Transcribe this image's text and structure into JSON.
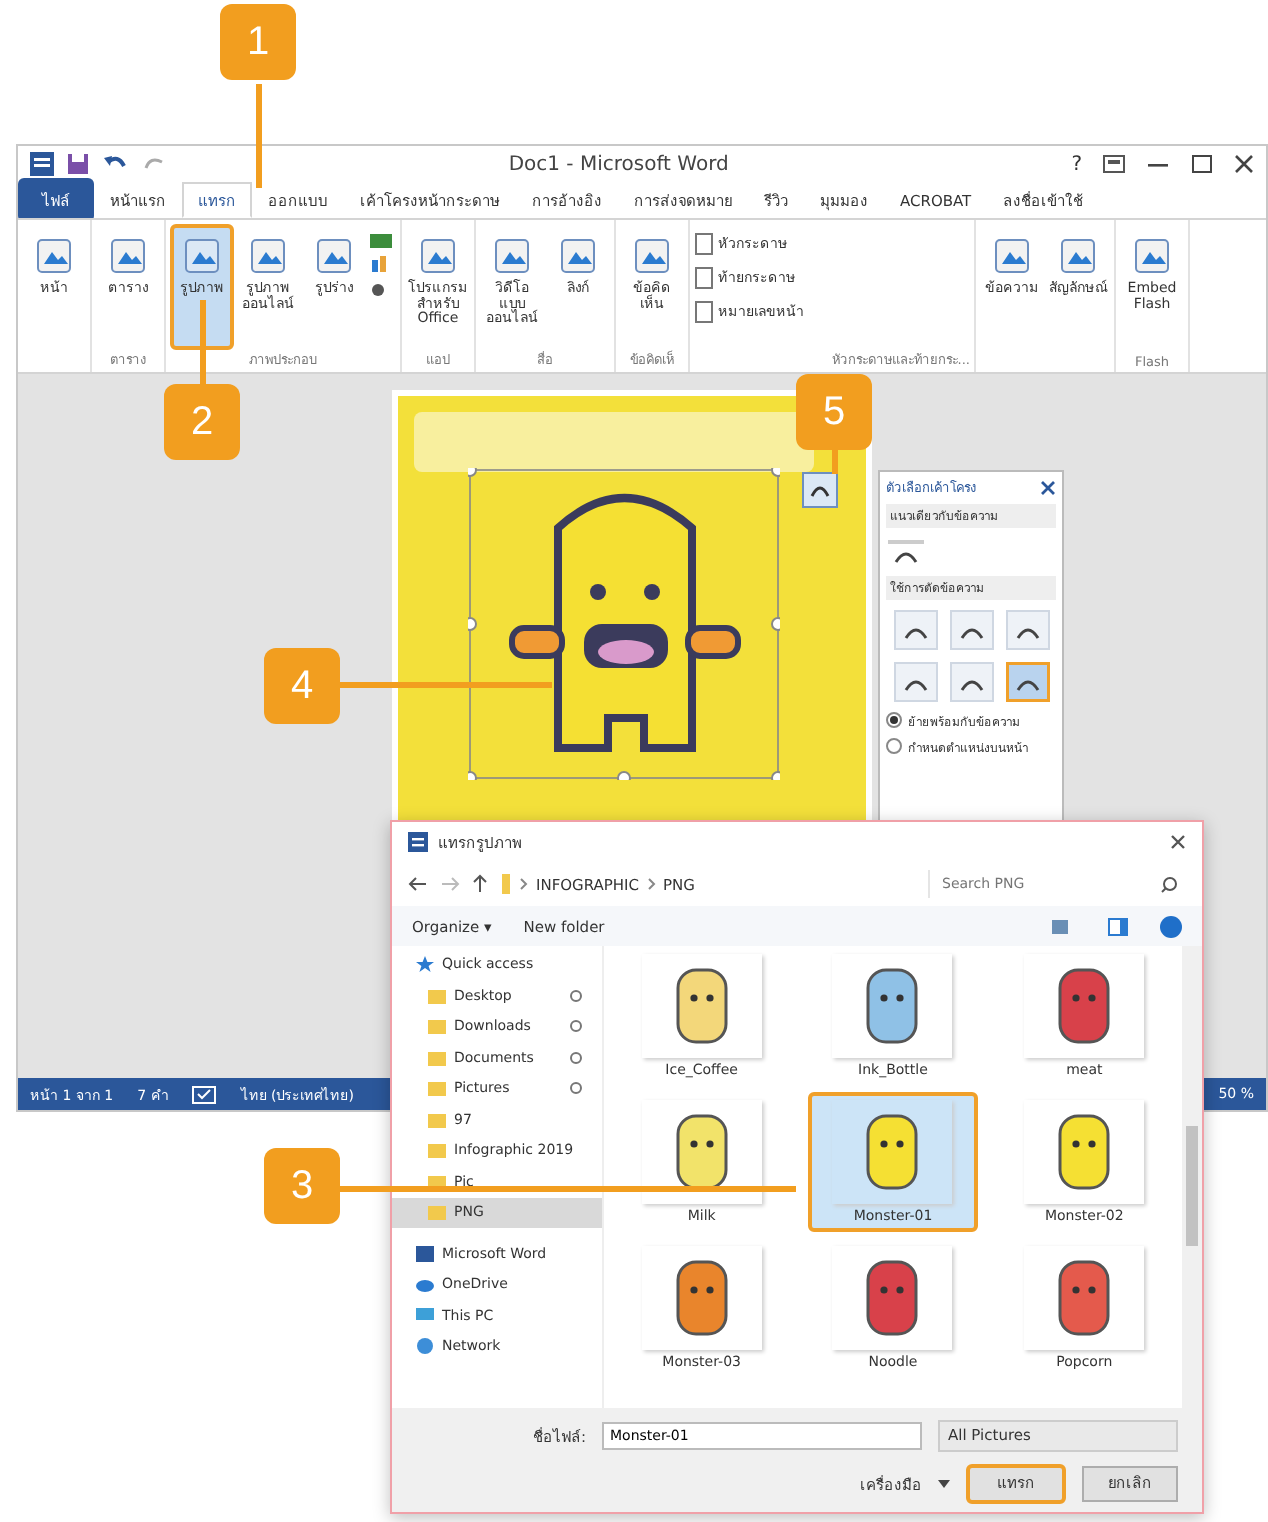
{
  "callouts": [
    {
      "label": "1"
    },
    {
      "label": "2"
    },
    {
      "label": "3"
    },
    {
      "label": "4"
    },
    {
      "label": "5"
    }
  ],
  "window": {
    "title": "Doc1 - Microsoft Word",
    "help": "?"
  },
  "tabs": [
    {
      "label": "ไฟล์",
      "kind": "file",
      "selected": false
    },
    {
      "label": "หน้าแรก",
      "kind": "tab",
      "selected": false
    },
    {
      "label": "แทรก",
      "kind": "tab",
      "selected": true
    },
    {
      "label": "ออกแบบ",
      "kind": "tab",
      "selected": false
    },
    {
      "label": "เค้าโครงหน้ากระดาษ",
      "kind": "tab",
      "selected": false
    },
    {
      "label": "การอ้างอิง",
      "kind": "tab",
      "selected": false
    },
    {
      "label": "การส่งจดหมาย",
      "kind": "tab",
      "selected": false
    },
    {
      "label": "รีวิว",
      "kind": "tab",
      "selected": false
    },
    {
      "label": "มุมมอง",
      "kind": "tab",
      "selected": false
    },
    {
      "label": "ACROBAT",
      "kind": "tab",
      "selected": false
    },
    {
      "label": "ลงชื่อเข้าใช้",
      "kind": "tab",
      "selected": false
    }
  ],
  "ribbon": [
    {
      "items": [
        {
          "label": "หน้า",
          "kind": "big",
          "selected": false
        }
      ]
    },
    {
      "label": "ตาราง",
      "items": [
        {
          "label": "ตาราง",
          "kind": "big",
          "selected": false
        }
      ]
    },
    {
      "label": "ภาพประกอบ",
      "items": [
        {
          "label": "รูปภาพ",
          "kind": "big",
          "selected": true
        },
        {
          "label": "รูปภาพออนไลน์",
          "kind": "big",
          "selected": false
        },
        {
          "label": "รูปร่าง",
          "kind": "big",
          "selected": false
        },
        {
          "kind": "stack",
          "selected": false
        }
      ]
    },
    {
      "label": "แอป",
      "items": [
        {
          "label": "โปรแกรมสำหรับ Office",
          "kind": "big",
          "selected": false
        }
      ]
    },
    {
      "label": "สื่อ",
      "items": [
        {
          "label": "วิดีโอแบบออนไลน์",
          "kind": "big",
          "selected": false
        },
        {
          "label": "ลิงก์",
          "kind": "big",
          "selected": false
        }
      ]
    },
    {
      "label": "ข้อคิดเห็",
      "items": [
        {
          "label": "ข้อคิดเห็น",
          "kind": "big",
          "selected": false
        }
      ]
    },
    {
      "label": "หัวกระดาษและท้ายกระ...",
      "items": [
        {
          "label": "หัวกระดาษ",
          "kind": "small",
          "selected": false
        },
        {
          "label": "ท้ายกระดาษ",
          "kind": "small",
          "selected": false
        },
        {
          "label": "หมายเลขหน้า",
          "kind": "small",
          "selected": false
        }
      ]
    },
    {
      "items": [
        {
          "label": "ข้อความ",
          "kind": "big",
          "selected": false
        },
        {
          "label": "สัญลักษณ์",
          "kind": "big",
          "selected": false
        }
      ]
    },
    {
      "label": "Flash",
      "items": [
        {
          "label": "Embed Flash",
          "kind": "big",
          "selected": false
        }
      ]
    }
  ],
  "layout_pane": {
    "title": "ตัวเลือกเค้าโครง",
    "inline_heading": "แนวเดียวกับข้อความ",
    "wrap_heading": "ใช้การตัดข้อความ",
    "wrap_options": [
      {
        "selected": false
      },
      {
        "selected": false
      },
      {
        "selected": false
      },
      {
        "selected": false
      },
      {
        "selected": false
      },
      {
        "selected": true
      }
    ],
    "position_options": [
      {
        "label": "ย้ายพร้อมกับข้อความ",
        "selected": true
      },
      {
        "label": "กำหนดตำแหน่งบนหน้า",
        "selected": false
      }
    ]
  },
  "status_bar": {
    "page": "หน้า 1 จาก 1",
    "words": "7 คำ",
    "language": "ไทย (ประเทศไทย)",
    "zoom": "50 %"
  },
  "dialog": {
    "title": "แทรกรูปภาพ",
    "path": [
      "INFOGRAPHIC",
      "PNG"
    ],
    "search_placeholder": "Search PNG",
    "organize": "Organize ▾",
    "new_folder": "New folder",
    "nav": [
      {
        "label": "Quick access",
        "kind": "star",
        "selected": false,
        "pinned": false
      },
      {
        "label": "Desktop",
        "kind": "folder",
        "selected": false,
        "pinned": true
      },
      {
        "label": "Downloads",
        "kind": "folder",
        "selected": false,
        "pinned": true
      },
      {
        "label": "Documents",
        "kind": "folder",
        "selected": false,
        "pinned": true
      },
      {
        "label": "Pictures",
        "kind": "folder",
        "selected": false,
        "pinned": true
      },
      {
        "label": "97",
        "kind": "folder",
        "selected": false,
        "pinned": false
      },
      {
        "label": "Infographic 2019",
        "kind": "folder",
        "selected": false,
        "pinned": false
      },
      {
        "label": "Pic",
        "kind": "folder",
        "selected": false,
        "pinned": false
      },
      {
        "label": "PNG",
        "kind": "folder",
        "selected": true,
        "pinned": false
      },
      {
        "label": "Microsoft Word",
        "kind": "word",
        "selected": false,
        "pinned": false
      },
      {
        "label": "OneDrive",
        "kind": "cloud",
        "selected": false,
        "pinned": false
      },
      {
        "label": "This PC",
        "kind": "pc",
        "selected": false,
        "pinned": false
      },
      {
        "label": "Network",
        "kind": "network",
        "selected": false,
        "pinned": false
      }
    ],
    "files": [
      {
        "name": "Ice_Coffee",
        "selected": false
      },
      {
        "name": "Ink_Bottle",
        "selected": false
      },
      {
        "name": "meat",
        "selected": false
      },
      {
        "name": "Milk",
        "selected": false
      },
      {
        "name": "Monster-01",
        "selected": true
      },
      {
        "name": "Monster-02",
        "selected": false
      },
      {
        "name": "Monster-03",
        "selected": false
      },
      {
        "name": "Noodle",
        "selected": false
      },
      {
        "name": "Popcorn",
        "selected": false
      }
    ],
    "filename_label": "ชื่อไฟล์:",
    "filename": "Monster-01",
    "filetype": "All Pictures",
    "tools": "เครื่องมือ",
    "insert": "แทรก",
    "cancel": "ยกเลิก"
  }
}
